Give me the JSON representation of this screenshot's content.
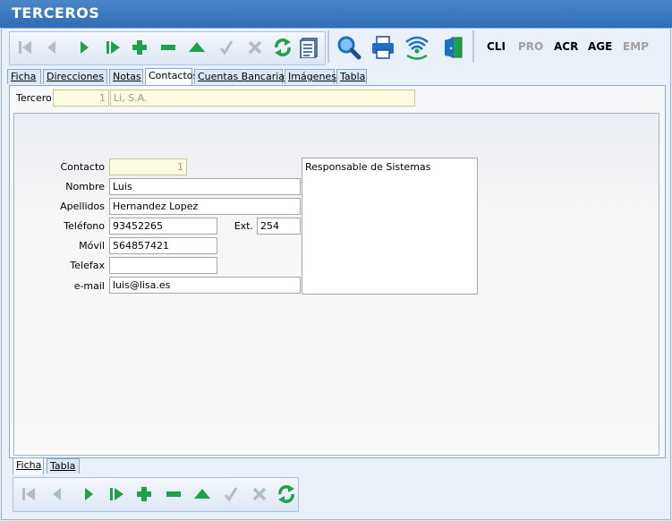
{
  "window": {
    "title": "TERCEROS"
  },
  "toolbar": {
    "modules": [
      {
        "label": "CLI",
        "enabled": true
      },
      {
        "label": "PRO",
        "enabled": false
      },
      {
        "label": "ACR",
        "enabled": true
      },
      {
        "label": "AGE",
        "enabled": true
      },
      {
        "label": "EMP",
        "enabled": false
      }
    ]
  },
  "tabs": [
    "Ficha",
    "Direcciones",
    "Notas",
    "Contactos",
    "Cuentas Bancarias",
    "Imágenes",
    "Tabla"
  ],
  "tabs_active": "Contactos",
  "tercero": {
    "label": "Tercero",
    "id": "1",
    "name": "Li, S.A."
  },
  "form": {
    "contacto_label": "Contacto",
    "contacto": "1",
    "nombre_label": "Nombre",
    "nombre": "Luis",
    "apellidos_label": "Apellidos",
    "apellidos": "Hernandez Lopez",
    "telefono_label": "Teléfono",
    "telefono": "93452265",
    "ext_label": "Ext.",
    "ext": "254",
    "movil_label": "Móvil",
    "movil": "564857421",
    "telefax_label": "Telefax",
    "telefax": "",
    "email_label": "e-mail",
    "email": "luis@lisa.es",
    "notes": "Responsable de Sistemas"
  },
  "bottom_tabs": [
    "Ficha",
    "Tabla"
  ],
  "bottom_tabs_active": "Ficha",
  "colors": {
    "green": "#1fa04a",
    "gray": "#b4bcc4",
    "blue": "#1d6fc4",
    "title_bar": "#3a78c0"
  }
}
